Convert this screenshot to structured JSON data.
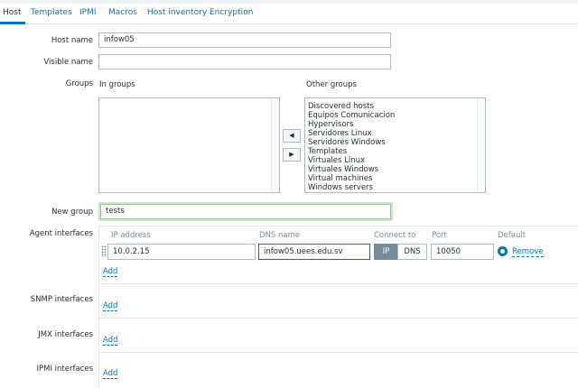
{
  "tabs": [
    {
      "label": "Host",
      "active": true
    },
    {
      "label": "Templates",
      "active": false
    },
    {
      "label": "IPMI",
      "active": false
    },
    {
      "label": "Macros",
      "active": false
    },
    {
      "label": "Host inventory",
      "active": false
    },
    {
      "label": "Encryption",
      "active": false
    }
  ],
  "form": {
    "host_name_label": "Host name",
    "host_name_value": "infow05",
    "visible_name_label": "Visible name",
    "visible_name_value": "",
    "groups_label": "Groups",
    "in_groups_label": "In groups",
    "other_groups_label": "Other groups",
    "in_groups": [],
    "other_groups": [
      "Discovered hosts",
      "Equipos Comunicacion",
      "Hypervisors",
      "Servidores Linux",
      "Servidores Windows",
      "Templates",
      "Virtuales Linux",
      "Virtuales Windows",
      "Virtual machines",
      "Windows servers"
    ],
    "move_left_glyph": "◀",
    "move_right_glyph": "▶",
    "new_group_label": "New group",
    "new_group_value": "tests"
  },
  "agent_interfaces": {
    "label": "Agent interfaces",
    "headers": {
      "ip_address": "IP address",
      "dns_name": "DNS name",
      "connect_to": "Connect to",
      "port": "Port",
      "default": "Default"
    },
    "row": {
      "ip_address": "10.0.2.15",
      "dns_name": "infow05.uees.edu.sv",
      "connect_ip": "IP",
      "connect_dns": "DNS",
      "connect_selected": "IP",
      "port": "10050",
      "default_selected": true,
      "remove_label": "Remove"
    },
    "add_label": "Add"
  },
  "snmp_interfaces": {
    "label": "SNMP interfaces",
    "add_label": "Add"
  },
  "jmx_interfaces": {
    "label": "JMX interfaces",
    "add_label": "Add"
  },
  "ipmi_interfaces": {
    "label": "IPMI interfaces",
    "add_label": "Add"
  },
  "colors": {
    "link": "#0275b8",
    "segment_active": "#768d99",
    "new_group_highlight": "#cde4cf"
  }
}
